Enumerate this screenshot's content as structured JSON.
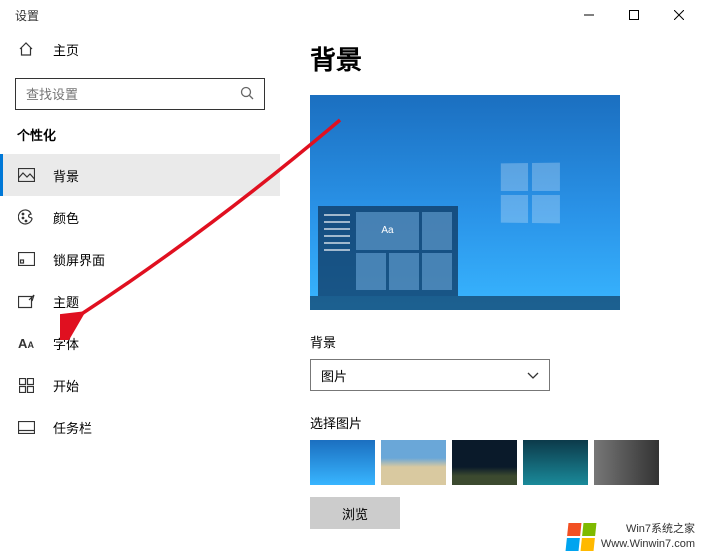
{
  "window": {
    "title": "设置"
  },
  "sidebar": {
    "home_label": "主页",
    "search_placeholder": "查找设置",
    "section_label": "个性化",
    "items": [
      {
        "label": "背景"
      },
      {
        "label": "颜色"
      },
      {
        "label": "锁屏界面"
      },
      {
        "label": "主题"
      },
      {
        "label": "字体"
      },
      {
        "label": "开始"
      },
      {
        "label": "任务栏"
      }
    ]
  },
  "main": {
    "page_title": "背景",
    "preview_tile_text": "Aa",
    "bg_label": "背景",
    "dropdown_value": "图片",
    "choose_label": "选择图片",
    "browse_label": "浏览"
  },
  "watermark": {
    "line1": "Win7系统之家",
    "line2": "Www.Winwin7.com"
  }
}
